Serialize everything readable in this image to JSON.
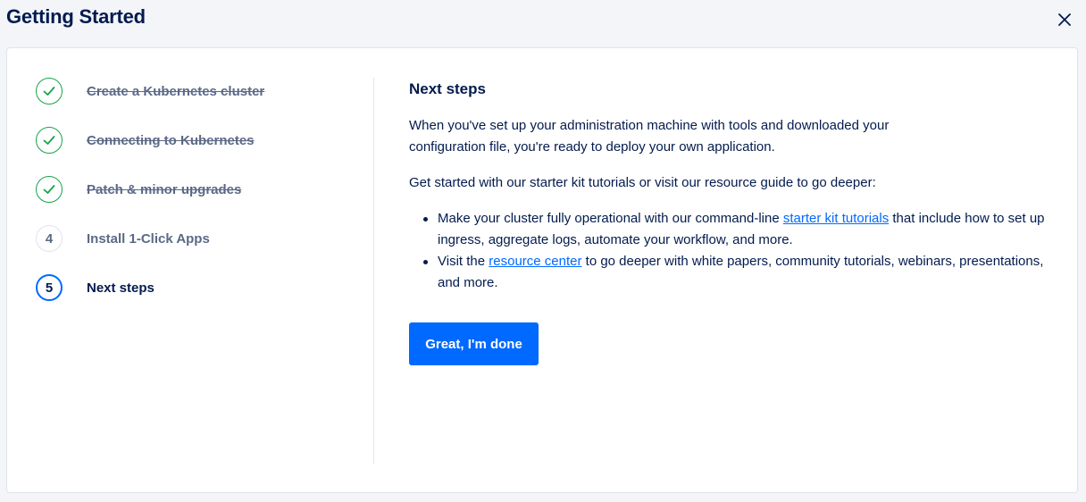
{
  "header": {
    "title": "Getting Started"
  },
  "steps": [
    {
      "label": "Create a Kubernetes cluster",
      "state": "done",
      "number": ""
    },
    {
      "label": "Connecting to Kubernetes",
      "state": "done",
      "number": ""
    },
    {
      "label": "Patch & minor upgrades",
      "state": "done",
      "number": ""
    },
    {
      "label": "Install 1-Click Apps",
      "state": "pending",
      "number": "4"
    },
    {
      "label": "Next steps",
      "state": "active",
      "number": "5"
    }
  ],
  "content": {
    "title": "Next steps",
    "intro": "When you've set up your administration machine with tools and downloaded your configuration file, you're ready to deploy your own application.",
    "lead": "Get started with our starter kit tutorials or visit our resource guide to go deeper:",
    "bullet1": {
      "before": "Make your cluster fully operational with our command-line ",
      "link": "starter kit tutorials",
      "after": " that include how to set up ingress, aggregate logs, automate your workflow, and more."
    },
    "bullet2": {
      "before": "Visit the ",
      "link": "resource center",
      "after": " to go deeper with white papers, community tutorials, webinars, presentations, and more."
    },
    "done_label": "Great, I'm done"
  },
  "colors": {
    "accent": "#0069ff",
    "success": "#15a54a",
    "text": "#031b4e",
    "muted": "#5b6987"
  }
}
